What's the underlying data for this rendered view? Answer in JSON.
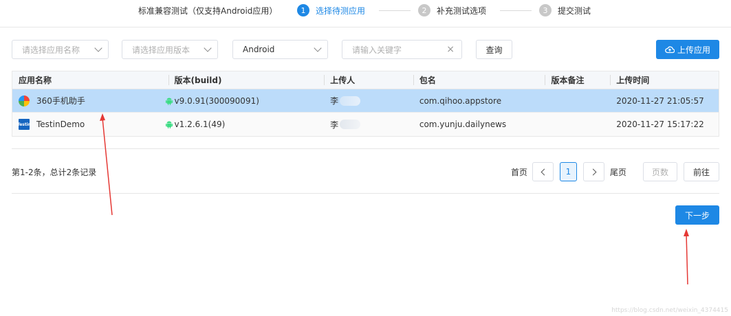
{
  "steps": {
    "title": "标准兼容测试（仅支持Android应用）",
    "items": [
      {
        "num": "1",
        "label": "选择待测应用"
      },
      {
        "num": "2",
        "label": "补充测试选项"
      },
      {
        "num": "3",
        "label": "提交测试"
      }
    ]
  },
  "filters": {
    "app_name_placeholder": "请选择应用名称",
    "app_version_placeholder": "请选择应用版本",
    "platform_value": "Android",
    "keyword_placeholder": "请输入关键字",
    "query_label": "查询",
    "upload_label": "上传应用"
  },
  "table": {
    "headers": [
      "应用名称",
      "版本(build)",
      "上传人",
      "包名",
      "版本备注",
      "上传时间"
    ],
    "rows": [
      {
        "name": "360手机助手",
        "version": "v9.0.91(300090091)",
        "uploader": "李",
        "package": "com.qihoo.appstore",
        "note": "",
        "time": "2020-11-27 21:05:57"
      },
      {
        "name": "TestinDemo",
        "version": "v1.2.6.1(49)",
        "uploader": "李",
        "package": "com.yunju.dailynews",
        "note": "",
        "time": "2020-11-27 15:17:22"
      }
    ],
    "testin_icon_text": "Testin"
  },
  "pagination": {
    "summary": "第1-2条，总计2条记录",
    "first_label": "首页",
    "current_page": "1",
    "last_label": "尾页",
    "page_input_placeholder": "页数",
    "go_label": "前往"
  },
  "next_label": "下一步",
  "colors": {
    "primary": "#1e88e5",
    "selected_row": "#bcdcfa",
    "android_green": "#3ddc84",
    "annotation_red": "#e53935"
  },
  "watermark": "https://blog.csdn.net/weixin_4374415"
}
